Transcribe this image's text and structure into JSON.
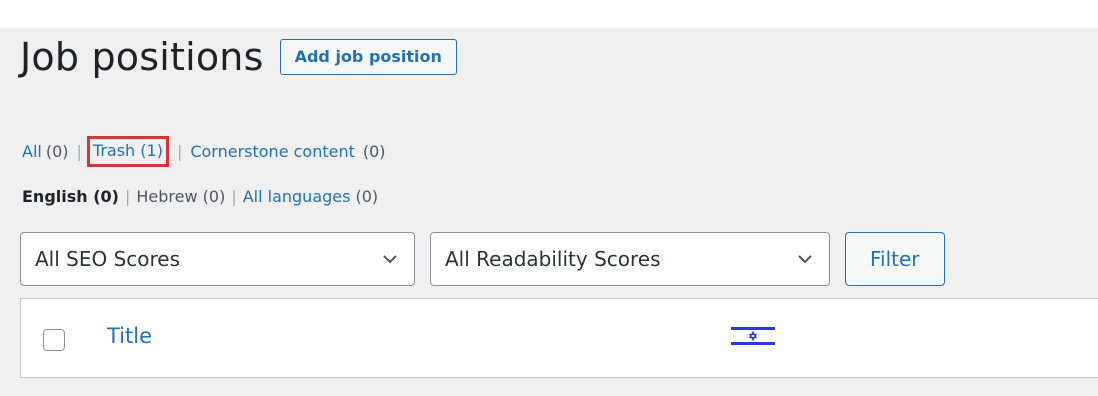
{
  "page": {
    "title": "Job positions",
    "add_button": "Add job position"
  },
  "views": {
    "all_label": "All",
    "all_count": "(0)",
    "trash_label": "Trash (1)",
    "cornerstone_label": "Cornerstone content",
    "cornerstone_count": "(0)",
    "separator": "|"
  },
  "languages": {
    "english": "English (0)",
    "hebrew": "Hebrew (0)",
    "all_label": "All languages",
    "all_count": "(0)",
    "separator": "|"
  },
  "filters": {
    "seo_selected": "All SEO Scores",
    "readability_selected": "All Readability Scores",
    "filter_button": "Filter"
  },
  "table": {
    "title_column": "Title",
    "language_column_icon": "israel-flag-icon"
  },
  "colors": {
    "link": "#2271b1",
    "highlight_box": "#d63638",
    "background": "#f0f0f1",
    "flag_blue": "#2b3bd6"
  }
}
